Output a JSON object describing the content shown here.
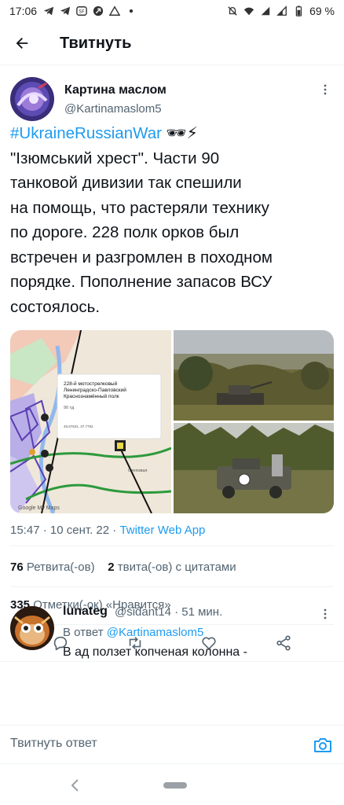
{
  "status_bar": {
    "time": "17:06",
    "battery": "69 %",
    "left_icons": [
      "telegram-icon",
      "telegram-icon",
      "badge-icon",
      "app-icon",
      "triangle-icon",
      "dot-icon"
    ],
    "right_icons": [
      "mute-icon",
      "wifi-icon",
      "signal-icon",
      "signal-icon",
      "battery-icon"
    ]
  },
  "header": {
    "title": "Твитнуть"
  },
  "tweet": {
    "author_name": "Картина маслом",
    "author_handle": "@Kartinamaslom5",
    "hashtag": "#UkraineRussianWar",
    "hashtag_emoji": "🕶⚡",
    "text_lines": [
      "\"Ізюмський хрест\". Части 90",
      "танковой дивизии так спешили",
      "на помощь, что растеряли технику",
      "по дороге. 228 полк орков был",
      "встречен и разгромлен в походном",
      "порядке. Пополнение запасов ВСУ",
      "состоялось."
    ],
    "map_popup": {
      "line1": "228-й мотострелковый",
      "line2": "Ленинградско-Павловский",
      "line3": "Краснознамённый полк",
      "detail": "90 тд",
      "coords": "49.67631, 37.7792"
    },
    "map_labels": {
      "corner": "Google My Maps",
      "place": "Степовая\nНовоселовка",
      "place2": "Боровая"
    },
    "time": "15:47",
    "date": "10 сент. 22",
    "source": "Twitter Web App",
    "retweets_count": "76",
    "retweets_label": "Ретвита(-ов)",
    "quotes_count": "2",
    "quotes_label": "твита(-ов) с цитатами",
    "likes_count": "335",
    "likes_label": "Отметки(-ок) «Нравится»"
  },
  "reply": {
    "name": "lunateg",
    "handle_time": "@sidant14 · 51 мин.",
    "reply_to_prefix": "В ответ ",
    "reply_to_handle": "@Kartinamaslom5",
    "text": "В ад ползет копченая колонна -"
  },
  "compose": {
    "placeholder": "Твитнуть ответ"
  },
  "colors": {
    "accent": "#1d9bf0",
    "text": "#0f1419",
    "secondary": "#536471",
    "divider": "#eff3f4"
  }
}
